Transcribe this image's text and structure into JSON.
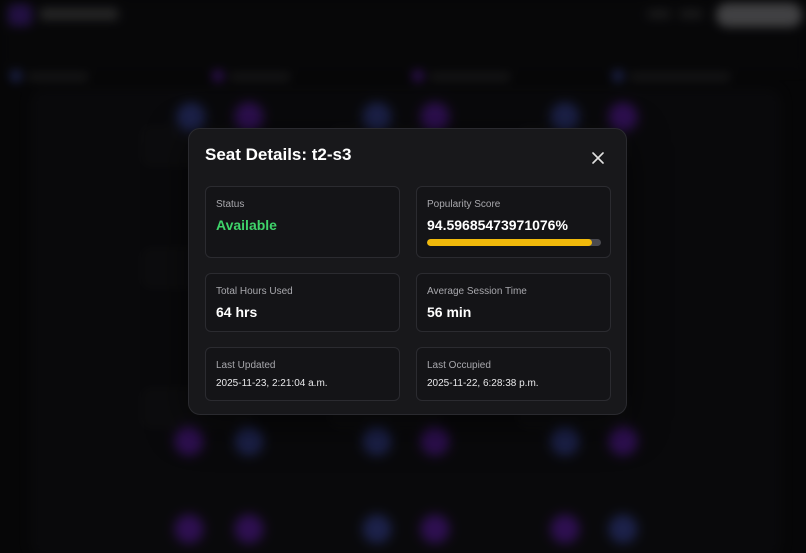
{
  "modal": {
    "title": "Seat Details: t2-s3",
    "status": {
      "label": "Status",
      "value": "Available",
      "color": "#3fd46a"
    },
    "popularity": {
      "label": "Popularity Score",
      "value": "94.59685473971076%",
      "percent": 94.59685473971076,
      "bar_color": "#f0b90b"
    },
    "hours": {
      "label": "Total Hours Used",
      "value": "64 hrs"
    },
    "session": {
      "label": "Average Session Time",
      "value": "56 min"
    },
    "updated": {
      "label": "Last Updated",
      "value": "2025-11-23, 2:21:04 a.m."
    },
    "occupied": {
      "label": "Last Occupied",
      "value": "2025-11-22, 6:28:38 p.m."
    },
    "close_icon": "close-icon"
  },
  "colors": {
    "seat_occupied": "#8f2cff",
    "seat_available": "#5566e8",
    "accent": "#6a2fd1"
  }
}
